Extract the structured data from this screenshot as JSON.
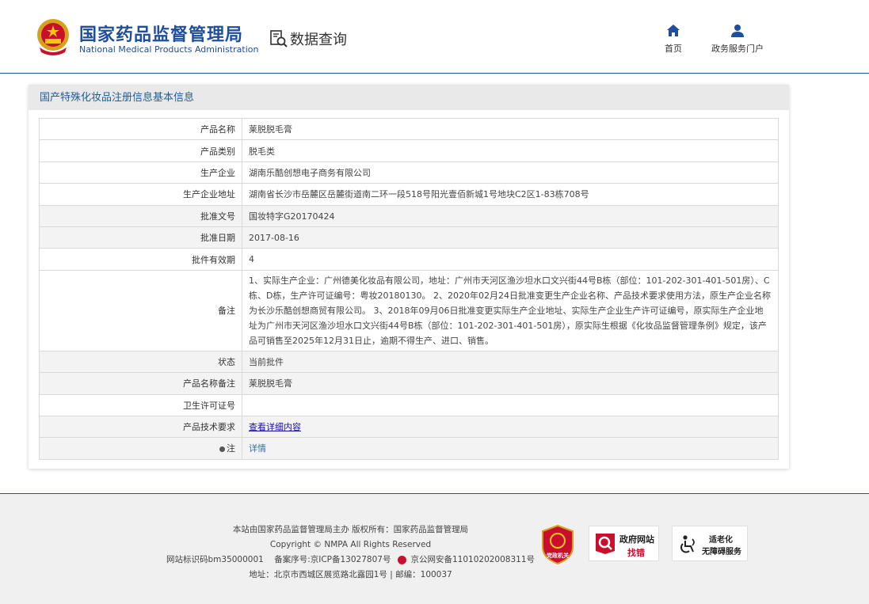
{
  "header": {
    "brand_cn": "国家药品监督管理局",
    "brand_en": "National Medical Products Administration",
    "query_label": "数据查询",
    "nav": [
      {
        "label": "首页",
        "icon": "home-icon"
      },
      {
        "label": "政务服务门户",
        "icon": "user-icon"
      }
    ]
  },
  "panel": {
    "title": "国产特殊化妆品注册信息基本信息",
    "rows": [
      {
        "key": "产品名称",
        "value": "莱脱脱毛膏"
      },
      {
        "key": "产品类别",
        "value": "脱毛类"
      },
      {
        "key": "生产企业",
        "value": "湖南乐酷创想电子商务有限公司"
      },
      {
        "key": "生产企业地址",
        "value": "湖南省长沙市岳麓区岳麓街道南二环一段518号阳光壹佰新城1号地块C2区1-83栋708号"
      },
      {
        "key": "批准文号",
        "value": "国妆特字G20170424"
      },
      {
        "key": "批准日期",
        "value": "2017-08-16"
      },
      {
        "key": "批件有效期",
        "value": "4"
      },
      {
        "key": "备注",
        "value": "1、实际生产企业：广州德美化妆品有限公司，地址：广州市天河区渔沙坦水口文兴街44号B栋（部位：101-202-301-401-501房）、C栋、D栋，生产许可证编号：粤妆20180130。 2、2020年02月24日批准变更生产企业名称、产品技术要求使用方法，原生产企业名称为长沙乐酷创想商贸有限公司。 3、2018年09月06日批准变更实际生产企业地址、实际生产企业生产许可证编号，原实际生产企业地址为广州市天河区渔沙坦水口文兴街44号B栋（部位：101-202-301-401-501房），原实际生根据《化妆品监督管理条例》规定，该产品可销售至2025年12月31日止，逾期不得生产、进口、销售。"
      },
      {
        "key": "状态",
        "value": "当前批件"
      },
      {
        "key": "产品名称备注",
        "value": "莱脱脱毛膏"
      },
      {
        "key": "卫生许可证号",
        "value": ""
      },
      {
        "key": "产品技术要求",
        "value": "查看详细内容"
      },
      {
        "key": "注",
        "value": "详情"
      }
    ]
  },
  "footer": {
    "line1": "本站由国家药品监督管理局主办 版权所有：国家药品监督管理局",
    "line2": "Copyright © NMPA All Rights Reserved",
    "line3a": "网站标识码bm35000001",
    "line3b": "备案序号:京ICP备13027807号",
    "line3c": "京公网安备11010202008311号",
    "line4": "地址：北京市西城区展览路北露园1号 | 邮编：100037",
    "badge_party": "党政机关",
    "badge_error_1": "政府网站",
    "badge_error_2": "找错",
    "badge_access_1": "适老化",
    "badge_access_2": "无障碍服务"
  },
  "colors": {
    "brand_blue": "#1f4e9a",
    "header_rule": "#1e5a8c",
    "party_red": "#c8102e",
    "link": "#1a0dab"
  }
}
